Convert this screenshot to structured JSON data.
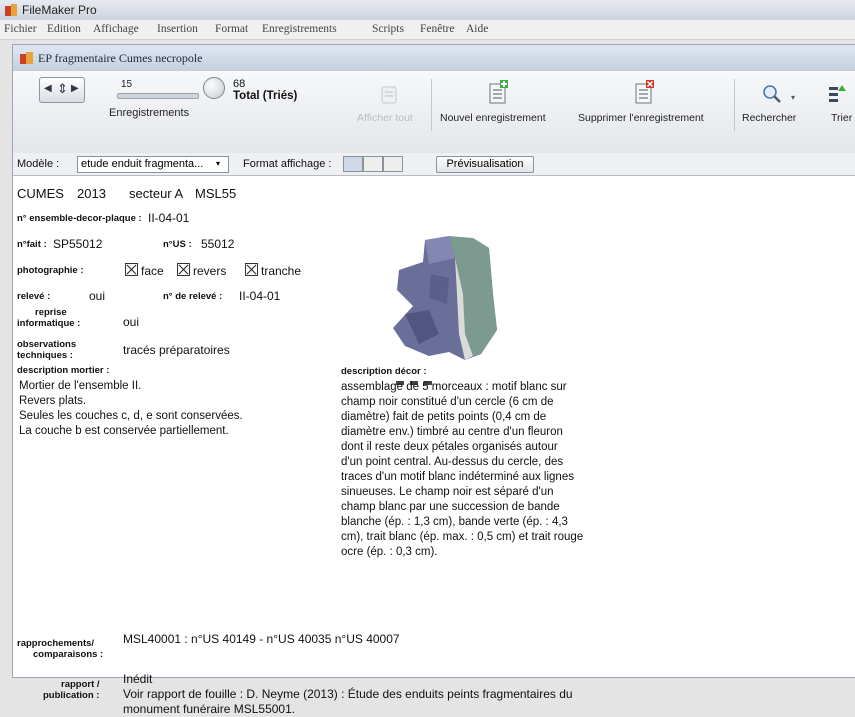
{
  "app": {
    "title": "FileMaker Pro"
  },
  "menu": [
    "Fichier",
    "Edition",
    "Affichage",
    "Insertion",
    "Format",
    "Enregistrements",
    "Scripts",
    "Fenêtre",
    "Aide"
  ],
  "window": {
    "title": "EP fragmentaire Cumes necropole"
  },
  "toolbar": {
    "record_number": "15",
    "records_label": "Enregistrements",
    "total_count": "68",
    "total_label": "Total (Triés)",
    "show_all": "Afficher tout",
    "new_record": "Nouvel enregistrement",
    "delete_record": "Supprimer l'enregistrement",
    "find": "Rechercher",
    "sort": "Trier"
  },
  "layout_bar": {
    "model_label": "Modèle :",
    "model_value": "etude enduit fragmenta...",
    "format_label": "Format affichage :",
    "preview_button": "Prévisualisation"
  },
  "record": {
    "header": {
      "site": "CUMES",
      "year": "2013",
      "sector": "secteur A",
      "code": "MSL55"
    },
    "ensemble_label": "n° ensemble-decor-plaque :",
    "ensemble_value": "II-04-01",
    "fait_label": "n°fait :",
    "fait_value": "SP55012",
    "us_label": "n°US :",
    "us_value": "55012",
    "photo_label": "photographie :",
    "photo_options": [
      "face",
      "revers",
      "tranche"
    ],
    "releve_label": "relevé :",
    "releve_value": "oui",
    "releve_num_label": "n° de relevé :",
    "releve_num_value": "II-04-01",
    "reprise_label_1": "reprise",
    "reprise_label_2": "informatique :",
    "reprise_value": "oui",
    "obs_label_1": "observations",
    "obs_label_2": "techniques :",
    "obs_value": "tracés préparatoires",
    "mortier_label": "description mortier :",
    "mortier_lines": [
      "Mortier de l'ensemble II.",
      "Revers plats.",
      "Seules les couches c, d, e sont conservées.",
      "La couche b est conservée partiellement."
    ],
    "decor_label": "description décor :",
    "decor_lines": [
      "assemblage de 5 morceaux : motif blanc sur",
      "champ noir constitué d'un cercle (6 cm de",
      "diamètre) fait de petits points (0,4 cm de",
      "diamètre env.) timbré au centre d'un fleuron",
      "dont il reste deux pétales organisés autour",
      "d'un point central. Au-dessus du cercle, des",
      "traces d'un motif blanc indéterminé aux lignes",
      "sinueuses. Le champ noir est séparé d'un",
      "champ blanc par une succession de bande",
      "blanche (ép. : 1,3 cm), bande verte (ép. : 4,3",
      "cm), trait blanc (ép. max. : 0,5 cm) et trait rouge",
      "ocre (ép. : 0,3 cm)."
    ],
    "rapprochements_label_1": "rapprochements/",
    "rapprochements_label_2": "comparaisons :",
    "rapprochements_value": "MSL40001 : n°US 40149 -  n°US 40035  n°US 40007",
    "rapport_label_1": "rapport /",
    "rapport_label_2": "publication :",
    "rapport_lines": [
      "Inédit",
      "Voir rapport de fouille : D. Neyme (2013) : Étude des enduits peints fragmentaires du",
      "monument funéraire MSL55001."
    ]
  }
}
